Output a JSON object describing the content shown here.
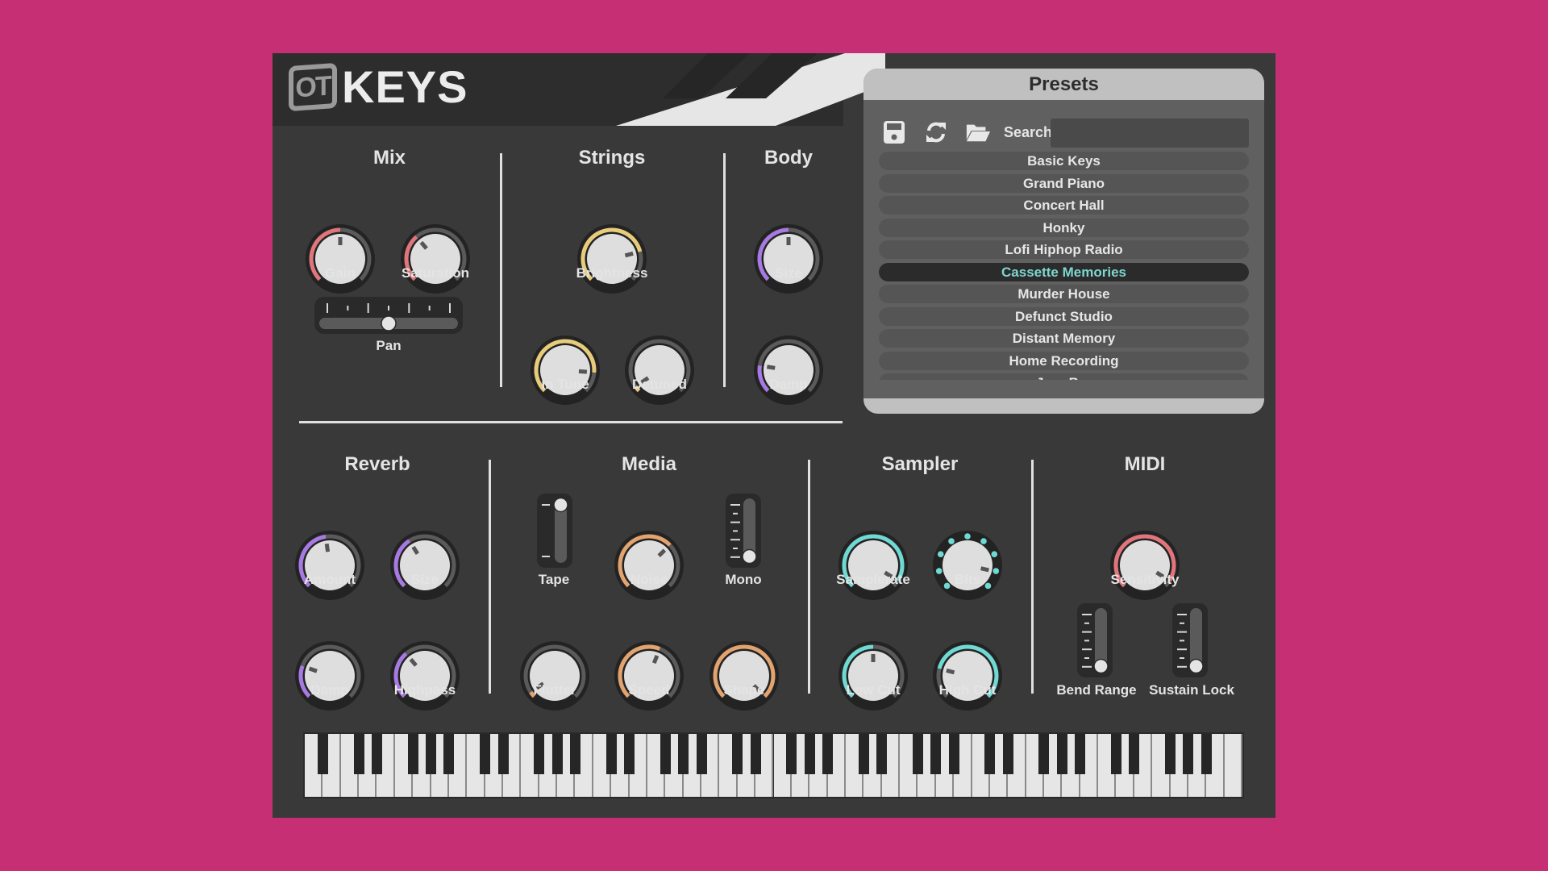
{
  "app": {
    "logo_badge": "OT",
    "title": "KEYS"
  },
  "colors": {
    "background": "#c62f74",
    "mix": "#e0767c",
    "strings": "#e8cc7a",
    "body": "#a779e3",
    "reverb": "#a779e3",
    "media": "#e2a36e",
    "sampler": "#6fd9d3",
    "midi": "#e0767c",
    "preset_selected_text": "#7fd6d0"
  },
  "sections": {
    "mix": {
      "title": "Mix",
      "gain": {
        "label": "Gain",
        "value": 0.5
      },
      "saturation": {
        "label": "Saturation",
        "value": 0.35
      },
      "pan": {
        "label": "Pan",
        "value": 0.5
      }
    },
    "strings": {
      "title": "Strings",
      "brightness": {
        "label": "Brightness",
        "value": 0.78
      },
      "in_tune": {
        "label": "In Tune",
        "value": 0.85
      },
      "detuned": {
        "label": "Detuned",
        "value": 0.04
      }
    },
    "body": {
      "title": "Body",
      "size": {
        "label": "Size",
        "value": 0.5
      },
      "damp": {
        "label": "Damp",
        "value": 0.2
      }
    },
    "reverb": {
      "title": "Reverb",
      "amount": {
        "label": "Amount",
        "value": 0.47
      },
      "size": {
        "label": "Size",
        "value": 0.38
      },
      "damp": {
        "label": "Damp",
        "value": 0.24
      },
      "highpass": {
        "label": "Highpass",
        "value": 0.35
      }
    },
    "media": {
      "title": "Media",
      "tape": {
        "label": "Tape",
        "value": 1
      },
      "noise": {
        "label": "Noise",
        "value": 0.67
      },
      "mono": {
        "label": "Mono",
        "value": 0
      },
      "flutter": {
        "label": "Flutter",
        "value": 0.04
      },
      "speed": {
        "label": "Speed",
        "value": 0.58
      },
      "shape": {
        "label": "Shape",
        "value": 1.0
      }
    },
    "sampler": {
      "title": "Sampler",
      "samplerate": {
        "label": "Samplerate",
        "value": 0.95
      },
      "bits": {
        "label": "Bits",
        "value": 0.88,
        "steps": 9
      },
      "low_cut": {
        "label": "Low Cut",
        "value": 0.5
      },
      "high_cut": {
        "label": "High Cut",
        "value": 0.22
      }
    },
    "midi": {
      "title": "MIDI",
      "sensitivity": {
        "label": "Sensitivity",
        "value": 0.95
      },
      "bend_range": {
        "label": "Bend Range",
        "value": 0
      },
      "sustain_lock": {
        "label": "Sustain Lock",
        "value": 0
      }
    }
  },
  "presets": {
    "title": "Presets",
    "toolbar": {
      "save_icon": "floppy-disk",
      "reload_icon": "refresh",
      "open_icon": "folder-open",
      "search_label": "Search"
    },
    "search_value": "",
    "items": [
      "Basic Keys",
      "Grand Piano",
      "Concert Hall",
      "Honky",
      "Lofi Hiphop Radio",
      "Cassette Memories",
      "Murder House",
      "Defunct Studio",
      "Distant Memory",
      "Home Recording",
      "Jazz Bar"
    ],
    "selected_index": 5
  },
  "keyboard": {
    "keys": 88,
    "first_note": "A0",
    "last_note": "C8"
  }
}
